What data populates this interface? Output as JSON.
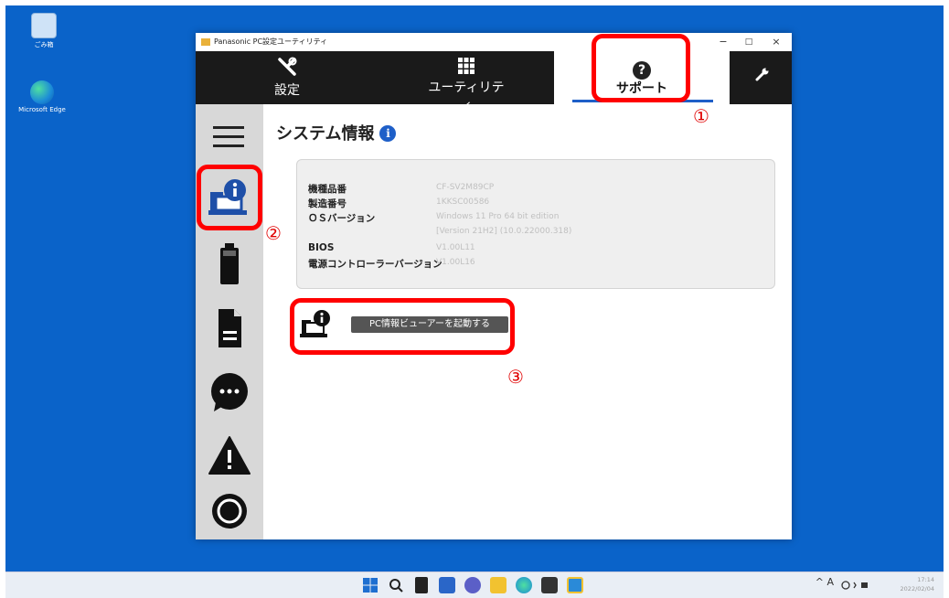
{
  "desktop": {
    "recycle_label": "ごみ箱",
    "edge_label": "Microsoft Edge"
  },
  "window": {
    "title": "Panasonic PC設定ユーティリティ",
    "minimize": "−",
    "maximize": "□",
    "close": "×"
  },
  "nav": {
    "settings_label": "設定",
    "settings_icon": "tools-icon",
    "utility_label": "ユーティリティ",
    "utility_icon": "grid-icon",
    "support_label": "サポート",
    "support_icon": "help-icon",
    "tools_icon": "wrench-icon"
  },
  "sidebar": {
    "items": [
      "menu",
      "system-info",
      "battery",
      "document",
      "chat",
      "warning",
      "target"
    ]
  },
  "content": {
    "title": "システム情報",
    "rows": [
      {
        "label": "機種品番",
        "value": "CF-SV2M89CP"
      },
      {
        "label": "製造番号",
        "value": "1KKSC00586"
      },
      {
        "label": "ＯＳバージョン",
        "value": "Windows 11 Pro 64 bit edition"
      },
      {
        "label": "",
        "value": "[Version 21H2] (10.0.22000.318)"
      },
      {
        "label": "BIOS",
        "value": "V1.00L11"
      },
      {
        "label": "電源コントローラーバージョン",
        "value": "V1.00L16"
      }
    ],
    "launch_button": "PC情報ビューアーを起動する"
  },
  "annotations": {
    "n1": "①",
    "n2": "②",
    "n3": "③",
    "color": "#ff0000"
  },
  "taskbar": {
    "tray": "^  A",
    "time": "17:14",
    "date": "2022/02/04"
  }
}
